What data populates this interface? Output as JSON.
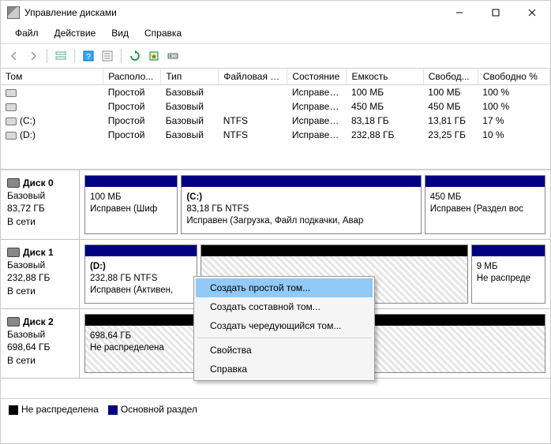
{
  "window": {
    "title": "Управление дисками"
  },
  "menubar": [
    "Файл",
    "Действие",
    "Вид",
    "Справка"
  ],
  "columns": [
    "Том",
    "Располо...",
    "Тип",
    "Файловая с...",
    "Состояние",
    "Емкость",
    "Свобод...",
    "Свободно %"
  ],
  "volumes": [
    {
      "name": "",
      "layout": "Простой",
      "type": "Базовый",
      "fs": "",
      "status": "Исправен...",
      "capacity": "100 МБ",
      "free": "100 МБ",
      "pct": "100 %"
    },
    {
      "name": "",
      "layout": "Простой",
      "type": "Базовый",
      "fs": "",
      "status": "Исправен...",
      "capacity": "450 МБ",
      "free": "450 МБ",
      "pct": "100 %"
    },
    {
      "name": "(C:)",
      "layout": "Простой",
      "type": "Базовый",
      "fs": "NTFS",
      "status": "Исправен...",
      "capacity": "83,18 ГБ",
      "free": "13,81 ГБ",
      "pct": "17 %"
    },
    {
      "name": "(D:)",
      "layout": "Простой",
      "type": "Базовый",
      "fs": "NTFS",
      "status": "Исправен...",
      "capacity": "232,88 ГБ",
      "free": "23,25 ГБ",
      "pct": "10 %"
    }
  ],
  "disks": [
    {
      "name": "Диск 0",
      "type": "Базовый",
      "size": "83,72 ГБ",
      "status": "В сети",
      "parts": [
        {
          "header": "primary",
          "title": "",
          "line1": "100 МБ",
          "line2": "Исправен (Шиф",
          "flex": 1,
          "hatched": false
        },
        {
          "header": "primary",
          "title": "(C:)",
          "line1": "83,18 ГБ NTFS",
          "line2": "Исправен (Загрузка, Файл подкачки, Авар",
          "flex": 2.6,
          "hatched": false
        },
        {
          "header": "primary",
          "title": "",
          "line1": "450 МБ",
          "line2": "Исправен (Раздел вос",
          "flex": 1.3,
          "hatched": false
        }
      ]
    },
    {
      "name": "Диск 1",
      "type": "Базовый",
      "size": "232,88 ГБ",
      "status": "В сети",
      "parts": [
        {
          "header": "primary",
          "title": "(D:)",
          "line1": "232,88 ГБ NTFS",
          "line2": "Исправен (Активен,",
          "flex": 1.3,
          "hatched": false
        },
        {
          "header": "unalloc",
          "title": "",
          "line1": "",
          "line2": "",
          "flex": 3.1,
          "hatched": true
        },
        {
          "header": "primary",
          "title": "",
          "line1": "9 МБ",
          "line2": "Не распреде",
          "flex": 0.85,
          "hatched": false
        }
      ]
    },
    {
      "name": "Диск 2",
      "type": "Базовый",
      "size": "698,64 ГБ",
      "status": "В сети",
      "parts": [
        {
          "header": "unalloc",
          "title": "",
          "line1": "698,64 ГБ",
          "line2": "Не распределена",
          "flex": 1,
          "hatched": true
        }
      ]
    }
  ],
  "legend": {
    "unalloc": "Не распределена",
    "primary": "Основной раздел"
  },
  "context_menu": {
    "items": [
      {
        "label": "Создать простой том...",
        "highlighted": true
      },
      {
        "label": "Создать составной том...",
        "highlighted": false
      },
      {
        "label": "Создать чередующийся том...",
        "highlighted": false
      }
    ],
    "items2": [
      {
        "label": "Свойства"
      },
      {
        "label": "Справка"
      }
    ]
  }
}
